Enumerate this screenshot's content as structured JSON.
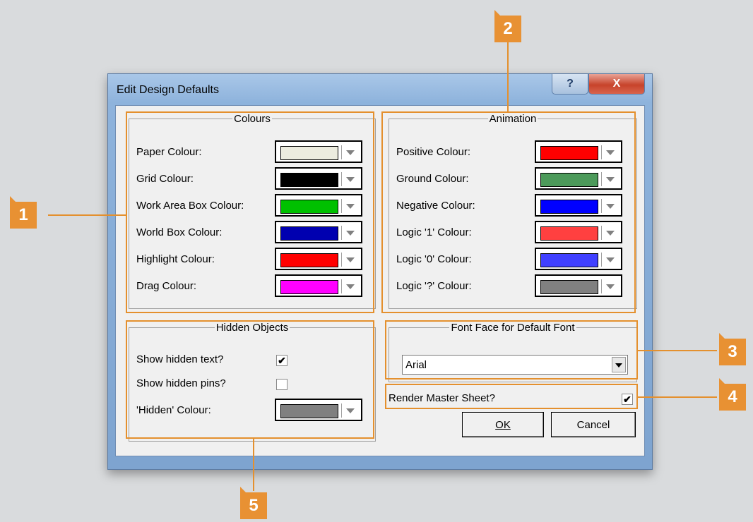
{
  "dialog": {
    "title": "Edit Design Defaults",
    "help_label": "?",
    "close_label": "X"
  },
  "colours": {
    "title": "Colours",
    "rows": [
      {
        "label": "Paper Colour:",
        "color": "#ececdf"
      },
      {
        "label": "Grid Colour:",
        "color": "#000000"
      },
      {
        "label": "Work Area Box Colour:",
        "color": "#00c000"
      },
      {
        "label": "World Box Colour:",
        "color": "#0000b0"
      },
      {
        "label": "Highlight Colour:",
        "color": "#ff0000"
      },
      {
        "label": "Drag Colour:",
        "color": "#ff00ff"
      }
    ]
  },
  "animation": {
    "title": "Animation",
    "rows": [
      {
        "label": "Positive Colour:",
        "color": "#ff0000"
      },
      {
        "label": "Ground Colour:",
        "color": "#4c9a5a"
      },
      {
        "label": "Negative Colour:",
        "color": "#0000ff"
      },
      {
        "label": "Logic '1' Colour:",
        "color": "#ff4040"
      },
      {
        "label": "Logic '0' Colour:",
        "color": "#4040ff"
      },
      {
        "label": "Logic '?' Colour:",
        "color": "#808080"
      }
    ]
  },
  "hidden_objects": {
    "title": "Hidden Objects",
    "show_text_label": "Show hidden text?",
    "show_text_checked": "✔",
    "show_pins_label": "Show hidden pins?",
    "show_pins_checked": "",
    "hidden_colour_label": "'Hidden' Colour:",
    "hidden_colour": "#808080"
  },
  "font_face": {
    "title": "Font Face for Default Font",
    "value": "Arial"
  },
  "render_master": {
    "label": "Render Master Sheet?",
    "checked": "✔"
  },
  "buttons": {
    "ok_label": "OK",
    "cancel_label": "Cancel"
  },
  "callouts": [
    "1",
    "2",
    "3",
    "4",
    "5"
  ],
  "accent_color": "#e89133"
}
